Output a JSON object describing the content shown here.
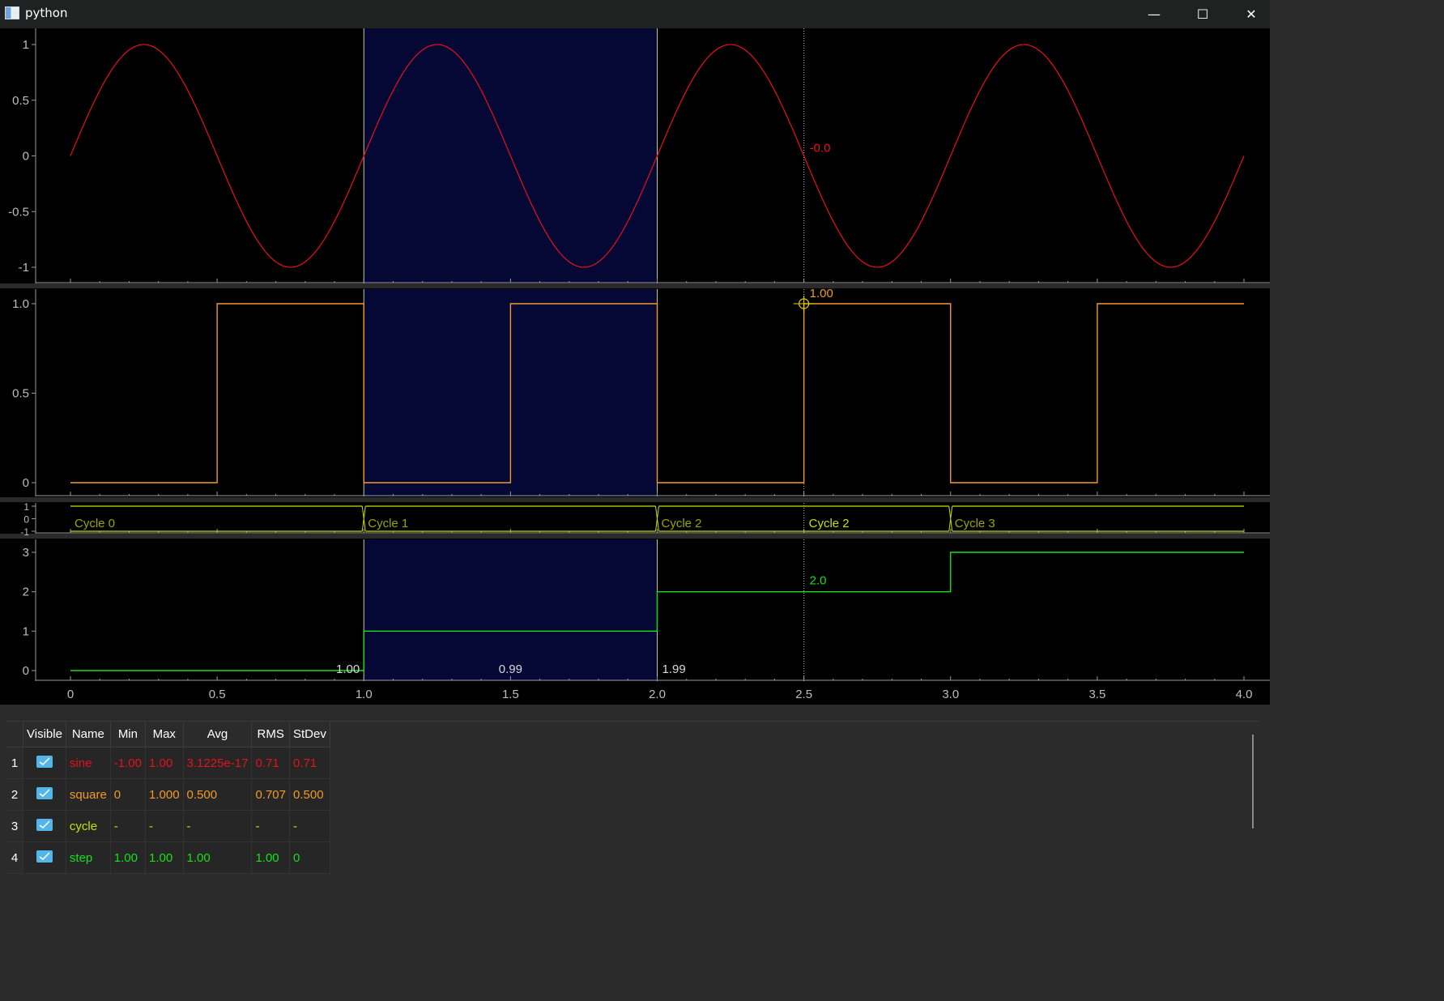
{
  "window": {
    "title": "python",
    "minimize": "—",
    "maximize": "☐",
    "close": "✕"
  },
  "colors": {
    "sine": "#e8101a",
    "square": "#f09a2a",
    "cycle": "#c8e000",
    "step": "#18e018",
    "region_fill": "#050734",
    "region_edge": "#c8c89a"
  },
  "chart_data": [
    {
      "type": "line",
      "series": [
        {
          "name": "sine",
          "function": "sin(2*pi*x)",
          "x_range": [
            0,
            4
          ]
        }
      ],
      "xlim": [
        0,
        4
      ],
      "ylim": [
        -1,
        1
      ],
      "yticks": [
        "-1",
        "-0.5",
        "0",
        "0.5",
        "1"
      ],
      "cursor": {
        "x": 2.5,
        "label": "-0.0"
      }
    },
    {
      "type": "line",
      "series": [
        {
          "name": "square",
          "points": [
            [
              0,
              0
            ],
            [
              0.5,
              0
            ],
            [
              0.5,
              1
            ],
            [
              1.0,
              1
            ],
            [
              1.0,
              0
            ],
            [
              1.5,
              0
            ],
            [
              1.5,
              1
            ],
            [
              2.0,
              1
            ],
            [
              2.0,
              0
            ],
            [
              2.5,
              0
            ],
            [
              2.5,
              1
            ],
            [
              3.0,
              1
            ],
            [
              3.0,
              0
            ],
            [
              3.5,
              0
            ],
            [
              3.5,
              1
            ],
            [
              4.0,
              1
            ]
          ]
        }
      ],
      "xlim": [
        0,
        4
      ],
      "ylim": [
        0,
        1
      ],
      "yticks": [
        "0",
        "0.5",
        "1.0"
      ],
      "cursor": {
        "x": 2.5,
        "y": 1.0,
        "label": "1.00"
      }
    },
    {
      "type": "line",
      "series": [
        {
          "name": "cycle"
        }
      ],
      "xlim": [
        0,
        4
      ],
      "ylim": [
        -1,
        1
      ],
      "yticks": [
        "-1",
        "0",
        "1"
      ],
      "segments": [
        {
          "x0": 0.0,
          "x1": 1.0,
          "label": "Cycle 0"
        },
        {
          "x0": 1.0,
          "x1": 2.0,
          "label": "Cycle 1"
        },
        {
          "x0": 2.0,
          "x1": 3.0,
          "label": "Cycle 2"
        },
        {
          "x0": 3.0,
          "x1": 4.0,
          "label": "Cycle 3"
        }
      ],
      "cursor": {
        "x": 2.5,
        "label": "Cycle 2"
      }
    },
    {
      "type": "line",
      "series": [
        {
          "name": "step",
          "points": [
            [
              0,
              0
            ],
            [
              1.0,
              0
            ],
            [
              1.0,
              1
            ],
            [
              2.0,
              1
            ],
            [
              2.0,
              2
            ],
            [
              3.0,
              2
            ],
            [
              3.0,
              3
            ],
            [
              4.0,
              3
            ]
          ]
        }
      ],
      "xlim": [
        0,
        4
      ],
      "ylim": [
        0,
        3
      ],
      "yticks": [
        "0",
        "1",
        "2",
        "3"
      ],
      "xticks": [
        "0",
        "0.5",
        "1.0",
        "1.5",
        "2.0",
        "2.5",
        "3.0",
        "3.5",
        "4.0"
      ],
      "region_labels": [
        {
          "x": 1.0,
          "label": "1.00",
          "side": "left"
        },
        {
          "x": 1.5,
          "label": "0.99",
          "side": "center"
        },
        {
          "x": 2.0,
          "label": "1.99",
          "side": "right"
        }
      ],
      "cursor": {
        "x": 2.5,
        "label": "2.0"
      }
    }
  ],
  "region": {
    "x0": 1.0,
    "x1": 2.0
  },
  "table": {
    "headers": [
      "Visible",
      "Name",
      "Min",
      "Max",
      "Avg",
      "RMS",
      "StDev"
    ],
    "rows": [
      {
        "index": "1",
        "visible": true,
        "name": "sine",
        "min": "-1.00",
        "max": "1.00",
        "avg": "3.1225e-17",
        "rms": "0.71",
        "stdev": "0.71",
        "color": "#e8101a"
      },
      {
        "index": "2",
        "visible": true,
        "name": "square",
        "min": "0",
        "max": "1.000",
        "avg": "0.500",
        "rms": "0.707",
        "stdev": "0.500",
        "color": "#f09a2a"
      },
      {
        "index": "3",
        "visible": true,
        "name": "cycle",
        "min": "-",
        "max": "-",
        "avg": "-",
        "rms": "-",
        "stdev": "-",
        "color": "#c8e000"
      },
      {
        "index": "4",
        "visible": true,
        "name": "step",
        "min": "1.00",
        "max": "1.00",
        "avg": "1.00",
        "rms": "1.00",
        "stdev": "0",
        "color": "#18e018"
      }
    ]
  }
}
